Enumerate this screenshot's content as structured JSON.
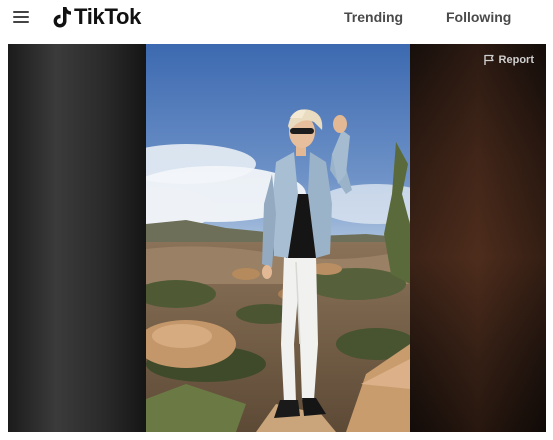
{
  "header": {
    "logo_text": "TikTok",
    "nav": [
      {
        "label": "Trending"
      },
      {
        "label": "Following"
      }
    ]
  },
  "video": {
    "report_label": "Report"
  },
  "icons": {
    "menu": "hamburger-menu-icon",
    "logo": "tiktok-note-icon",
    "report": "flag-icon"
  },
  "colors": {
    "sky_top": "#3f6fb5",
    "sky_bottom": "#a9c2e0",
    "jacket": "#9bb3c9",
    "pants": "#f0f0ee",
    "rocks": "#b58a5c"
  }
}
